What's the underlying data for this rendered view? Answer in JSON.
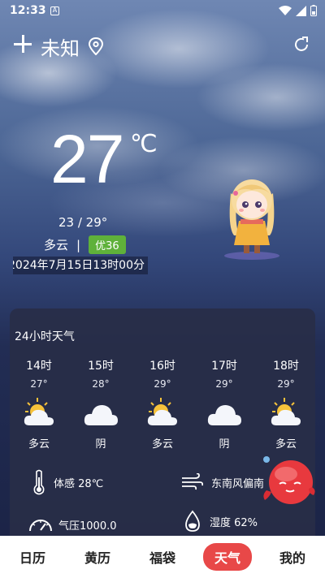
{
  "status_bar": {
    "time": "12:33",
    "notif_icon": "A"
  },
  "header": {
    "city": "未知"
  },
  "current": {
    "temp": "27",
    "unit": "℃",
    "range": "23 / 29°",
    "condition": "多云",
    "separator": "|",
    "aqi": "优36",
    "datetime": "2024年7月15日13时00分"
  },
  "forecast": {
    "title": "24小时天气",
    "hours": [
      {
        "hour": "14时",
        "temp": "27°",
        "cond": "多云",
        "icon": "partly-cloudy"
      },
      {
        "hour": "15时",
        "temp": "28°",
        "cond": "阴",
        "icon": "overcast"
      },
      {
        "hour": "16时",
        "temp": "29°",
        "cond": "多云",
        "icon": "partly-cloudy"
      },
      {
        "hour": "17时",
        "temp": "29°",
        "cond": "阴",
        "icon": "overcast"
      },
      {
        "hour": "18时",
        "temp": "29°",
        "cond": "多云",
        "icon": "partly-cloudy"
      }
    ]
  },
  "details": {
    "feel": "体感  28℃",
    "wind": "东南风偏南",
    "pressure": "气压1000.0",
    "humidity": "湿度  62%"
  },
  "nav": {
    "items": [
      "日历",
      "黄历",
      "福袋",
      "天气",
      "我的"
    ],
    "active": "天气"
  },
  "colors": {
    "aqi_good": "#5fb13a",
    "nav_active": "#e84848"
  }
}
